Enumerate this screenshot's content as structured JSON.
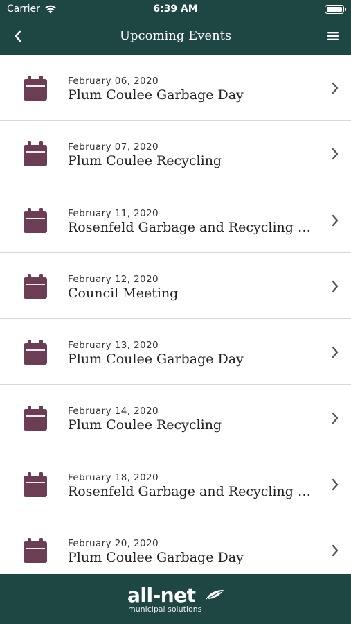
{
  "status_bar": {
    "carrier": "Carrier",
    "time": "6:39 AM"
  },
  "nav": {
    "title": "Upcoming Events",
    "back_icon": "chevron-left-icon",
    "menu_icon": "hamburger-menu-icon"
  },
  "events": [
    {
      "date": "February 06, 2020",
      "title": "Plum Coulee Garbage Day"
    },
    {
      "date": "February 07, 2020",
      "title": "Plum Coulee Recycling"
    },
    {
      "date": "February 11, 2020",
      "title": "Rosenfeld Garbage and Recycling P..."
    },
    {
      "date": "February 12, 2020",
      "title": "Council Meeting"
    },
    {
      "date": "February 13, 2020",
      "title": "Plum Coulee Garbage Day"
    },
    {
      "date": "February 14, 2020",
      "title": "Plum Coulee Recycling"
    },
    {
      "date": "February 18, 2020",
      "title": "Rosenfeld Garbage and Recycling P..."
    },
    {
      "date": "February 20, 2020",
      "title": "Plum Coulee Garbage Day"
    }
  ],
  "footer": {
    "brand": "all-net",
    "tagline": "municipal solutions"
  },
  "colors": {
    "header_bg": "#1e4743",
    "calendar_icon": "#6b3e55",
    "chevron": "#555555"
  }
}
